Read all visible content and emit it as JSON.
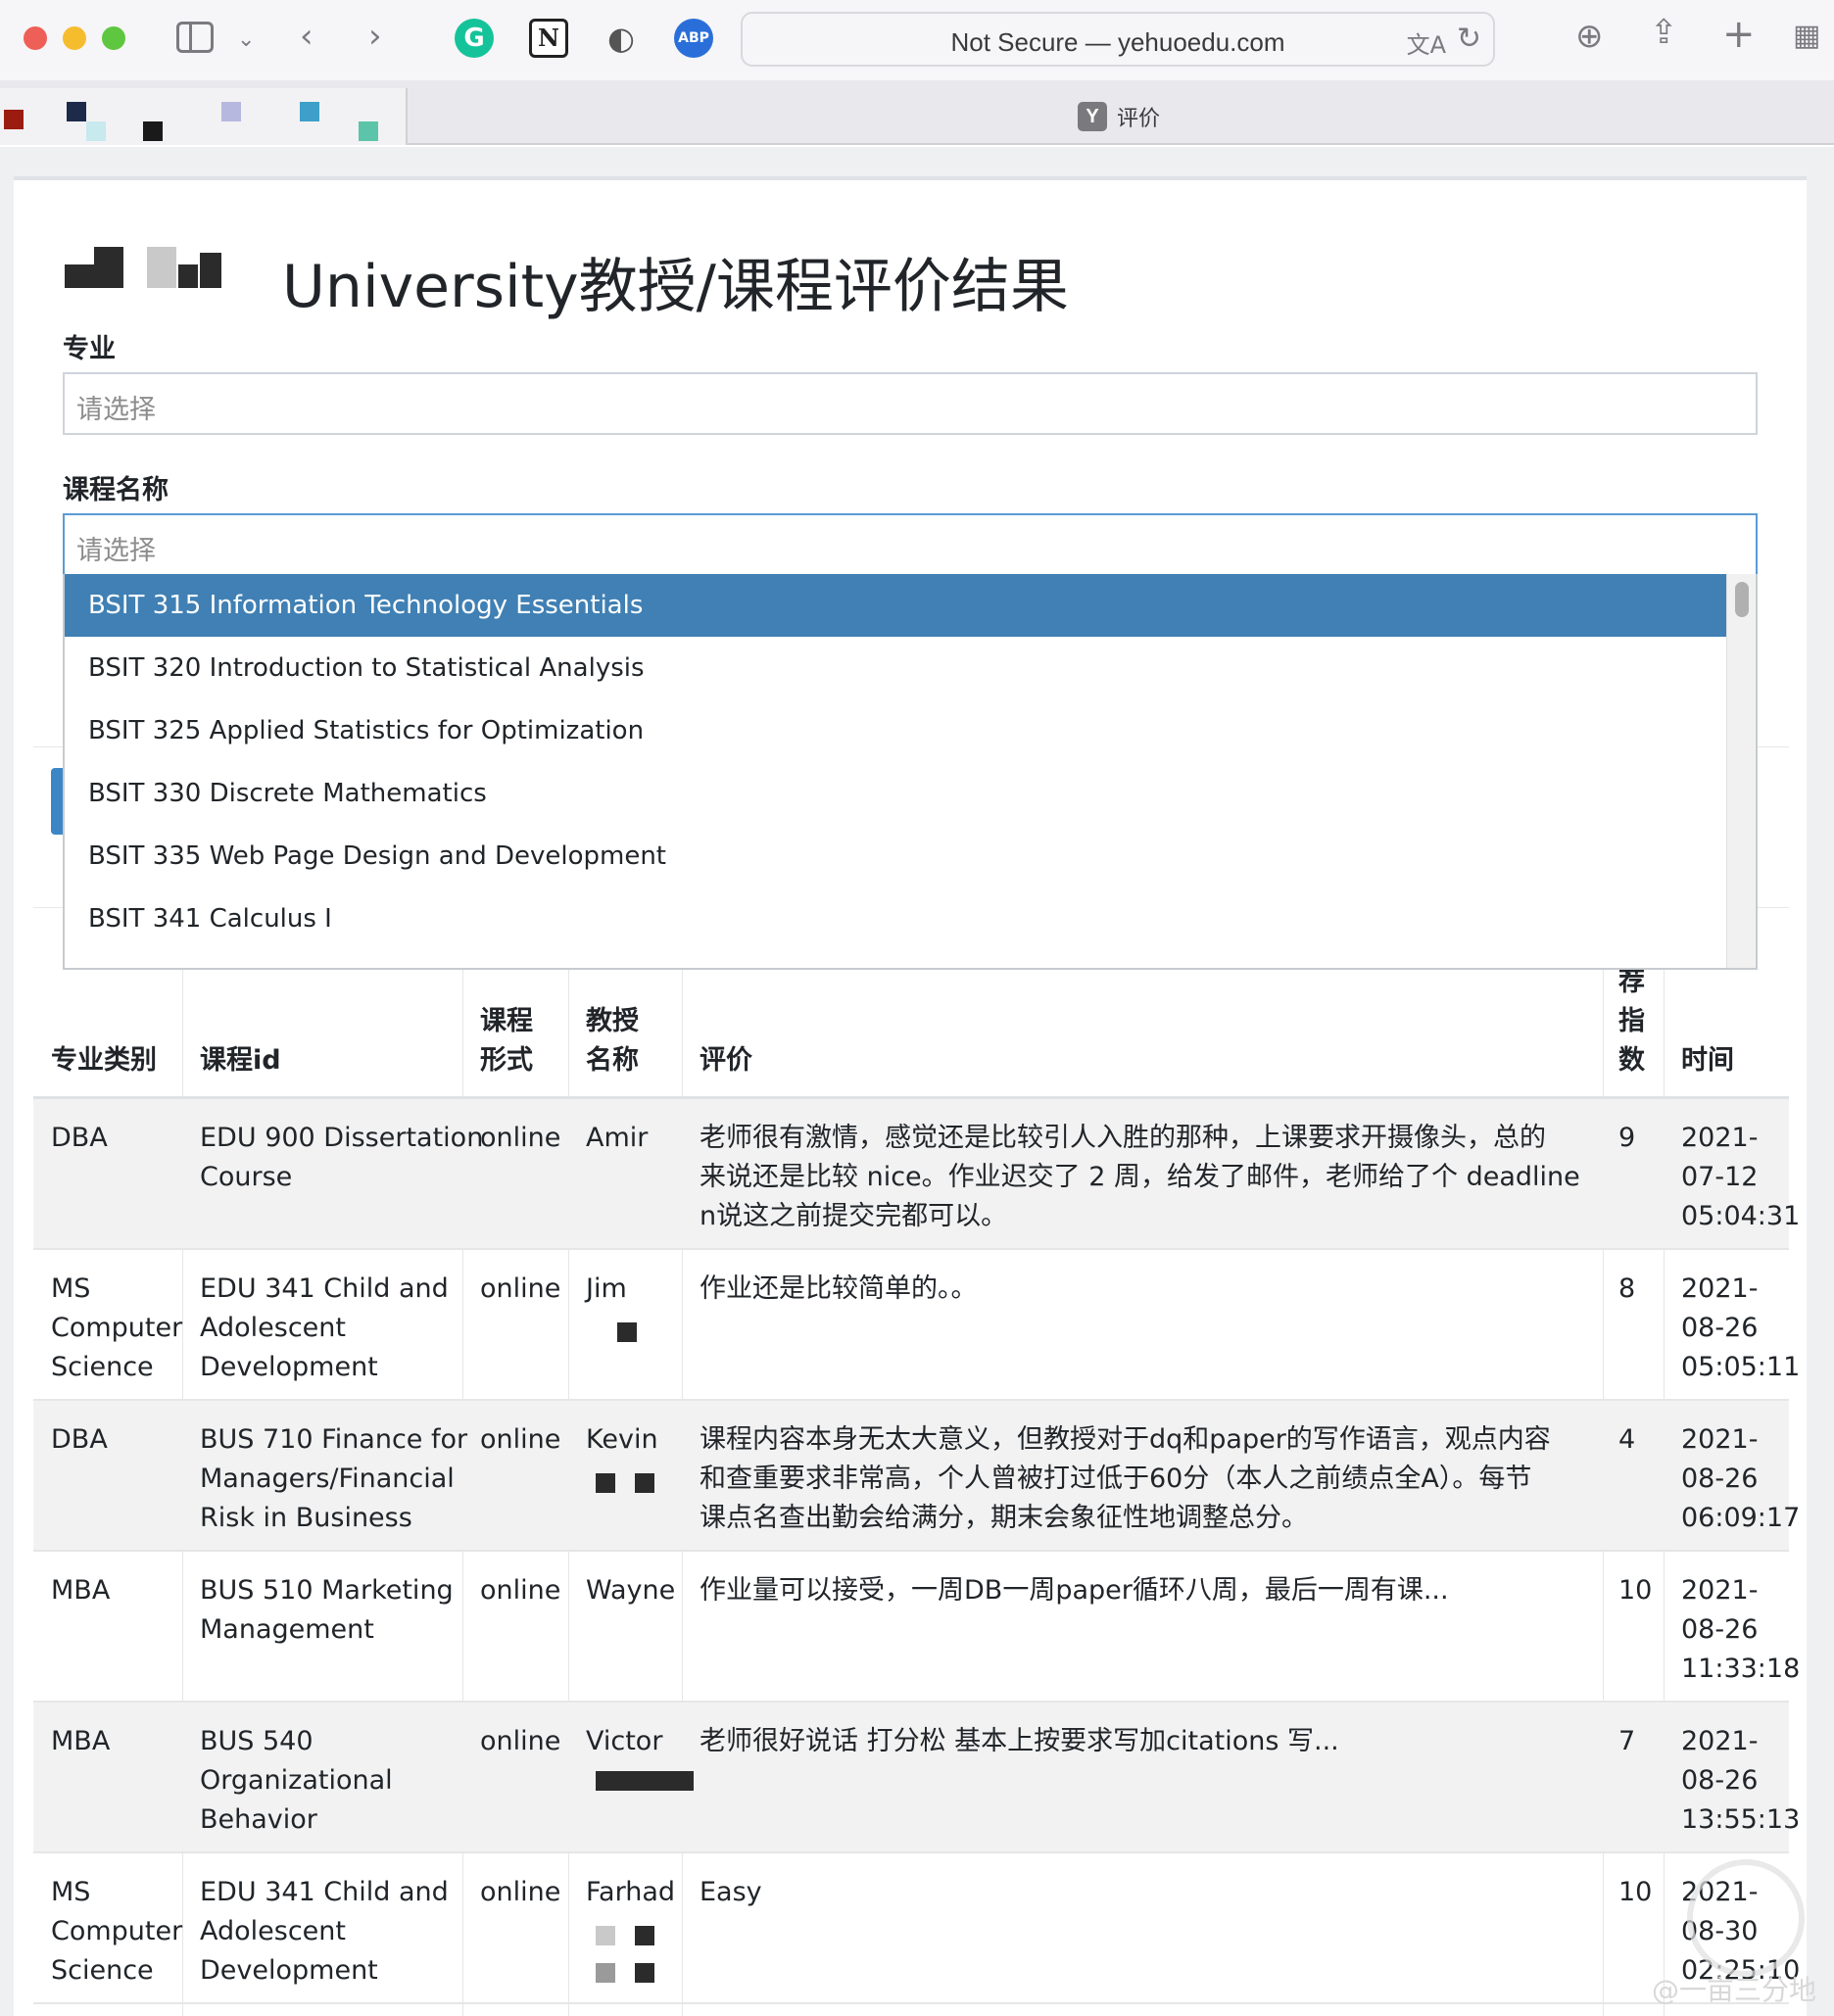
{
  "browser": {
    "url": "Not Secure — yehuoedu.com",
    "tab_title": "评价",
    "tab_favicon": "Y",
    "extensions": {
      "grammarly": "G",
      "notion": "N",
      "abp": "ABP"
    }
  },
  "page": {
    "title": "University教授/课程评价结果"
  },
  "filters": {
    "major_label": "专业",
    "major_placeholder": "请选择",
    "course_label": "课程名称",
    "course_placeholder": "请选择"
  },
  "dropdown": {
    "options": [
      "BSIT 315 Information Technology Essentials",
      "BSIT 320 Introduction to Statistical Analysis",
      "BSIT 325 Applied Statistics for Optimization",
      "BSIT 330 Discrete Mathematics",
      "BSIT 335 Web Page Design and Development",
      "BSIT 341 Calculus I"
    ],
    "highlighted_index": 0
  },
  "table": {
    "headers": {
      "major": "专业类别",
      "course_id": "课程id",
      "format_1": "课程",
      "format_2": "形式",
      "prof_1": "教授",
      "prof_2": "名称",
      "review": "评价",
      "score_1": "荐",
      "score_2": "指",
      "score_3": "数",
      "time": "时间"
    },
    "rows": [
      {
        "major": [
          "DBA"
        ],
        "course": [
          "EDU 900 Dissertation",
          "Course"
        ],
        "format": "online",
        "prof": "Amir",
        "review": [
          "老师很有激情，感觉还是比较引人入胜的那种，上课要求开摄像头，总的",
          "来说还是比较 nice。作业迟交了 2 周，给发了邮件，老师给了个 deadline",
          "n说这之前提交完都可以。"
        ],
        "score": "9",
        "time": [
          "2021-",
          "07-12",
          "05:04:31"
        ]
      },
      {
        "major": [
          "MS",
          "Computer",
          "Science"
        ],
        "course": [
          "EDU 341 Child and",
          "Adolescent",
          "Development"
        ],
        "format": "online",
        "prof": "Jim",
        "review": [
          "作业还是比较简单的。。"
        ],
        "score": "8",
        "time": [
          "2021-",
          "08-26",
          "05:05:11"
        ]
      },
      {
        "major": [
          "DBA"
        ],
        "course": [
          "BUS 710 Finance for",
          "Managers/Financial",
          "Risk in Business"
        ],
        "format": "online",
        "prof": "Kevin",
        "review": [
          "课程内容本身无太大意义，但教授对于dq和paper的写作语言，观点内容",
          "和查重要求非常高，个人曾被打过低于60分（本人之前绩点全A）。每节",
          "课点名查出勤会给满分，期末会象征性地调整总分。"
        ],
        "score": "4",
        "time": [
          "2021-",
          "08-26",
          "06:09:17"
        ]
      },
      {
        "major": [
          "MBA"
        ],
        "course": [
          "BUS 510 Marketing",
          "Management"
        ],
        "format": "online",
        "prof": "Wayne",
        "review": [
          "作业量可以接受，一周DB一周paper循环八周，最后一周有课..."
        ],
        "score": "10",
        "time": [
          "2021-",
          "08-26",
          "11:33:18"
        ]
      },
      {
        "major": [
          "MBA"
        ],
        "course": [
          "BUS 540",
          "Organizational",
          "Behavior"
        ],
        "format": "online",
        "prof": "Victor",
        "review": [
          "老师很好说话 打分松 基本上按要求写加citations 写..."
        ],
        "score": "7",
        "time": [
          "2021-",
          "08-26",
          "13:55:13"
        ]
      },
      {
        "major": [
          "MS",
          "Computer",
          "Science"
        ],
        "course": [
          "EDU 341 Child and",
          "Adolescent",
          "Development"
        ],
        "format": "online",
        "prof": "Farhad",
        "review": [
          "Easy"
        ],
        "score": "10",
        "time": [
          "2021-",
          "08-30",
          "02:25:10"
        ]
      }
    ]
  },
  "watermark": "@一亩三分地"
}
